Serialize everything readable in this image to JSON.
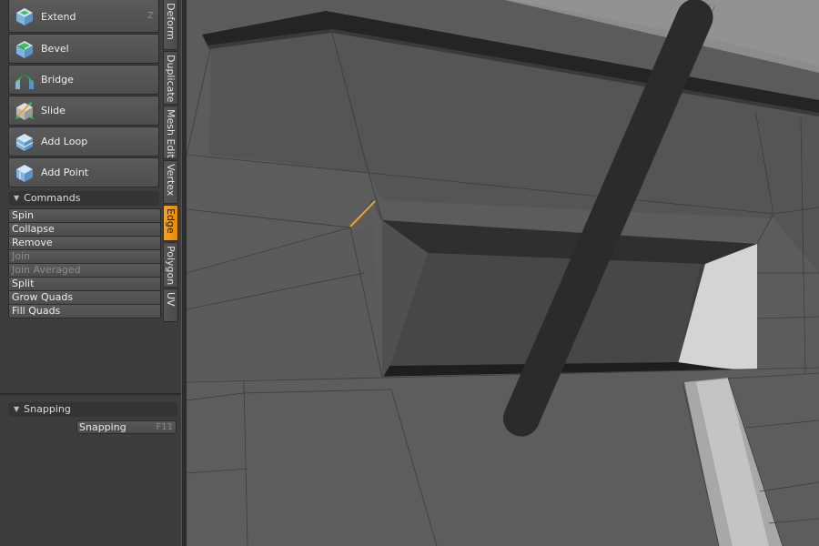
{
  "toolbox": {
    "tools": [
      {
        "label": "Extend",
        "shortcut": "Z",
        "icon": "extend-icon"
      },
      {
        "label": "Bevel",
        "shortcut": "",
        "icon": "bevel-icon"
      },
      {
        "label": "Bridge",
        "shortcut": "",
        "icon": "bridge-icon"
      },
      {
        "label": "Slide",
        "shortcut": "",
        "icon": "slide-icon"
      },
      {
        "label": "Add Loop",
        "shortcut": "",
        "icon": "add-loop-icon"
      },
      {
        "label": "Add Point",
        "shortcut": "",
        "icon": "add-point-icon"
      }
    ],
    "commands_header": "Commands",
    "commands": [
      {
        "label": "Spin",
        "enabled": true
      },
      {
        "label": "Collapse",
        "enabled": true
      },
      {
        "label": "Remove",
        "enabled": true
      },
      {
        "label": "Join",
        "enabled": false
      },
      {
        "label": "Join Averaged",
        "enabled": false
      },
      {
        "label": "Split",
        "enabled": true
      },
      {
        "label": "Grow Quads",
        "enabled": true
      },
      {
        "label": "Fill Quads",
        "enabled": true
      }
    ],
    "snapping_header": "Snapping",
    "snapping_button": {
      "label": "Snapping",
      "shortcut": "F11"
    }
  },
  "vertical_tabs": [
    {
      "label": "Deform",
      "active": false
    },
    {
      "label": "Duplicate",
      "active": false
    },
    {
      "label": "Mesh Edit",
      "active": false
    },
    {
      "label": "Vertex",
      "active": false
    },
    {
      "label": "Edge",
      "active": true
    },
    {
      "label": "Polygon",
      "active": false
    },
    {
      "label": "UV",
      "active": false
    }
  ],
  "colors": {
    "accent": "#f39c1d",
    "panel_bg": "#3d3d3d",
    "button_bg": "#525252",
    "viewport_bg": "#5a5a5a",
    "selected_edge": "#f0a030"
  }
}
